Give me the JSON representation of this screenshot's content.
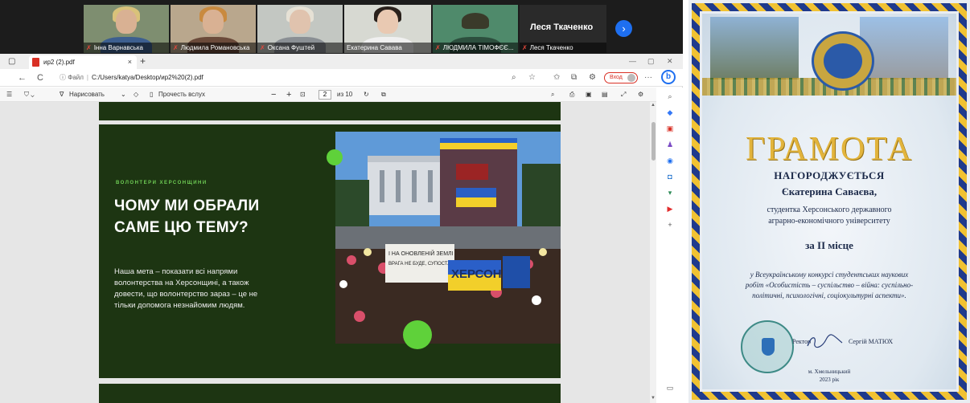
{
  "zoom": {
    "participants": [
      {
        "name": "Інна Варнавська"
      },
      {
        "name": "Людмила Романовська"
      },
      {
        "name": "Оксана Фуштей"
      },
      {
        "name": "Екатерина Савава"
      },
      {
        "name": "ЛЮДМИЛА ТІМОФЄЄ..."
      },
      {
        "name": "Леся Ткаченко"
      }
    ],
    "speaker_name": "Леся Ткаченко",
    "next_icon": "chevron-right-icon"
  },
  "browser": {
    "tab_title": "ир2 (2).pdf",
    "tab_close": "×",
    "new_tab": "+",
    "back": "←",
    "refresh": "C",
    "url_label": "Файл",
    "url": "C:/Users/katya/Desktop/ир2%20(2).pdf",
    "sign_in": "Вход",
    "more": "···",
    "pdf_toolbar": {
      "draw": "Нарисовать",
      "read_aloud": "Прочесть вслух",
      "zoom_out": "−",
      "zoom_in": "+",
      "page": "2",
      "of_pages": "из 10"
    }
  },
  "slide": {
    "kicker": "ВОЛОНТЕРИ ХЕРСОНЩИНИ",
    "headline_line1": "ЧОМУ МИ ОБРАЛИ",
    "headline_line2": "САМЕ ЦЮ ТЕМУ?",
    "body_lines": [
      "Наша мета – показати всі напрями",
      "волонтерства на Херсонщині, а також",
      "довести, що волонтерство зараз – це не",
      "тільки допомога незнайомим людям."
    ],
    "photo_sign_1": "І НА ОНОВЛЕНІЙ ЗЕМЛІ",
    "photo_sign_2": "ВРАГА НЕ БУДЕ, СУПОСТАТА",
    "photo_sign_3": "ХЕРСОН"
  },
  "certificate": {
    "title": "ГРАМОТА",
    "awarded": "НАГОРОДЖУЄТЬСЯ",
    "recipient": "Єкатерина Саваєва,",
    "desc_line1": "студентка Херсонського державного",
    "desc_line2": "аграрно-економічного університету",
    "place": "за II місце",
    "contest_line1": "у Всеукраїнському конкурсі студентських наукових",
    "contest_line2": "робіт «Особистість – суспільство – війна: суспільно-",
    "contest_line3": "політичні, психологічні, соціокультурні аспекти».",
    "rector_label": "Ректор",
    "rector_name": "Сергій МАТЮХ",
    "city": "м. Хмельницький",
    "year": "2023 рік"
  }
}
